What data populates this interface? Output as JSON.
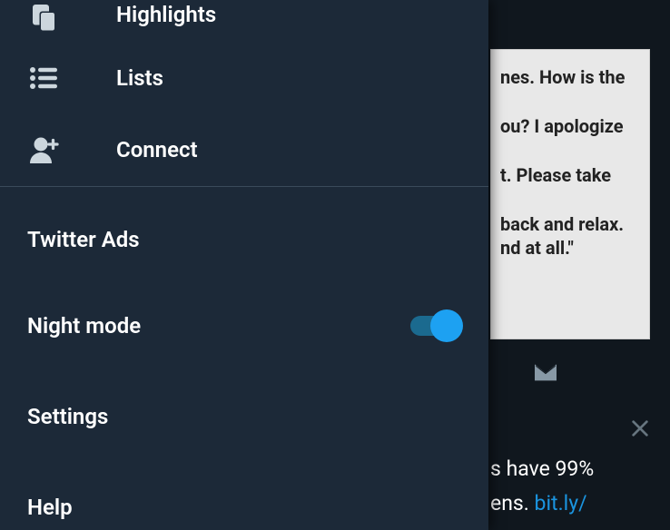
{
  "drawer": {
    "items": [
      {
        "label": "Highlights",
        "icon": "highlights-icon"
      },
      {
        "label": "Lists",
        "icon": "lists-icon"
      },
      {
        "label": "Connect",
        "icon": "connect-icon"
      }
    ],
    "settings": [
      {
        "label": "Twitter Ads"
      },
      {
        "label": "Night mode",
        "toggle": true,
        "enabled": true
      },
      {
        "label": "Settings"
      },
      {
        "label": "Help"
      }
    ]
  },
  "feed": {
    "card_lines": [
      "nes. How is the",
      "ou? I apologize",
      "t. Please take",
      "back and relax.",
      "nd at all.\""
    ],
    "post2_line1": "s have 99%",
    "post2_line2": "ens.  ",
    "post2_link": "bit.ly/"
  },
  "colors": {
    "accent": "#1da1f2",
    "drawer_bg": "#1c2938",
    "feed_bg": "#10171e",
    "link": "#1b95e0"
  }
}
